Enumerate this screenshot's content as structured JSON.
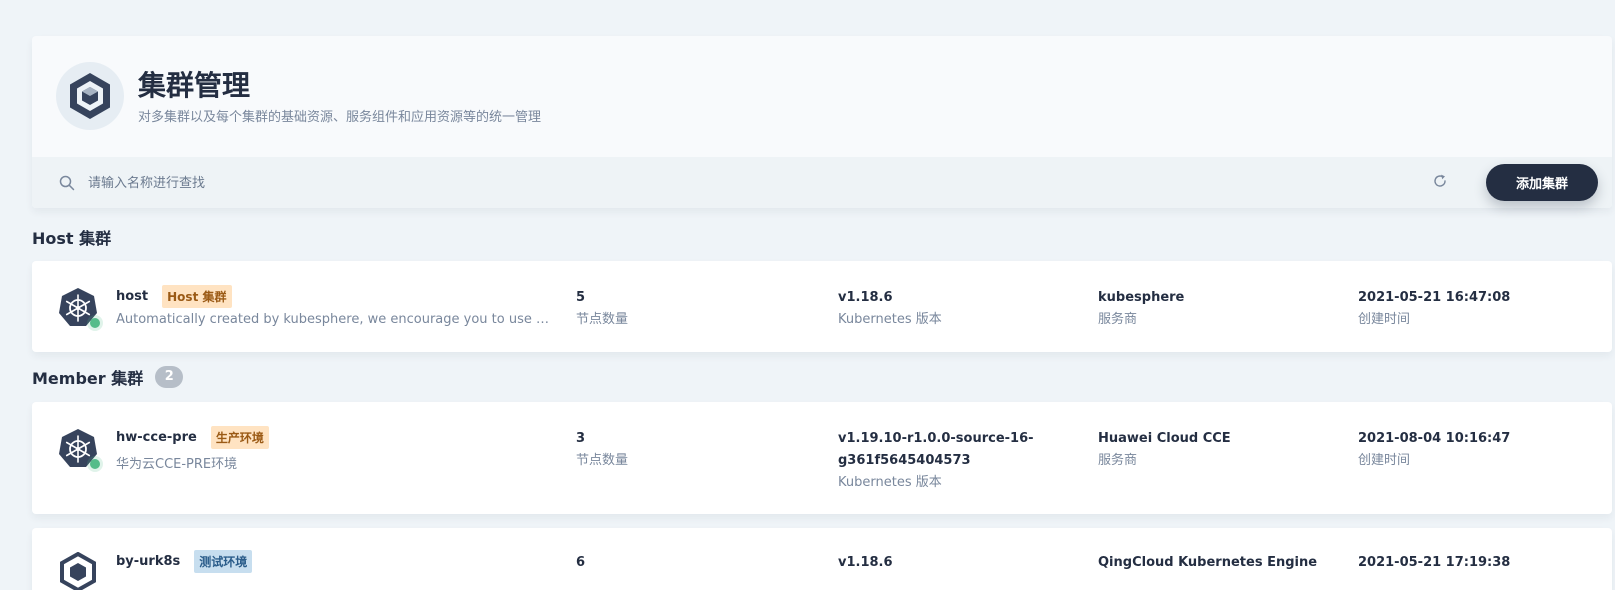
{
  "header": {
    "title": "集群管理",
    "description": "对多集群以及每个集群的基础资源、服务组件和应用资源等的统一管理"
  },
  "toolbar": {
    "search_placeholder": "请输入名称进行查找",
    "add_button_label": "添加集群"
  },
  "sections": {
    "host_title": "Host 集群",
    "member_title": "Member 集群",
    "member_count": "2"
  },
  "labels": {
    "nodes": "节点数量",
    "version": "Kubernetes 版本",
    "provider": "服务商",
    "created": "创建时间"
  },
  "host_cluster": {
    "name": "host",
    "tag": "Host 集群",
    "description": "Automatically created by kubesphere, we encourage you to use host ...",
    "nodes": "5",
    "version": "v1.18.6",
    "provider": "kubesphere",
    "created": "2021-05-21 16:47:08"
  },
  "member_clusters": [
    {
      "name": "hw-cce-pre",
      "tag": "生产环境",
      "description": "华为云CCE-PRE环境",
      "nodes": "3",
      "version": "v1.19.10-r1.0.0-source-16-g361f5645404573",
      "provider": "Huawei Cloud CCE",
      "created": "2021-08-04 10:16:47"
    },
    {
      "name": "by-urk8s",
      "tag": "测试环境",
      "nodes": "6",
      "version": "v1.18.6",
      "provider": "QingCloud Kubernetes Engine",
      "created": "2021-05-21 17:19:38"
    }
  ],
  "colors": {
    "background": "#eff4f8",
    "dark": "#242e42",
    "status_ok": "#55bc8a",
    "tag_warm": "#ffe3c2",
    "tag_blue": "#c7deef"
  },
  "icons": {
    "logo": "cube-icon",
    "search": "search-icon",
    "refresh": "refresh-icon",
    "cluster": "kubernetes-icon"
  }
}
